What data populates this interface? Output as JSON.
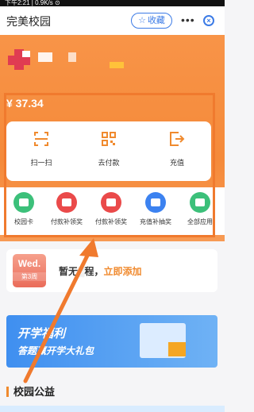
{
  "status_bar": {
    "text": "下午2:21 | 0.9K/s ⊙"
  },
  "app_bar": {
    "title": "完美校园",
    "favorite_label": "收藏",
    "more_icon": "more-dots-icon",
    "close_icon": "close-circle-icon"
  },
  "wallet": {
    "balance": "¥ 37.34"
  },
  "actions": [
    {
      "label": "扫一扫",
      "icon": "scan-icon"
    },
    {
      "label": "去付款",
      "icon": "qrcode-icon"
    },
    {
      "label": "充值",
      "icon": "recharge-icon"
    }
  ],
  "apps": [
    {
      "label": "校园卡",
      "color": "#3cc07a"
    },
    {
      "label": "付款补领奖",
      "color": "#ea4a4a"
    },
    {
      "label": "付款补领奖",
      "color": "#ea4a4a"
    },
    {
      "label": "充值补抽奖",
      "color": "#3c82f0"
    },
    {
      "label": "全部应用",
      "color": "#3cc07a"
    }
  ],
  "schedule": {
    "day": "Wed.",
    "week": "第3周",
    "text_prefix": "暂无",
    "text_mid": "程，",
    "link": "立即添加"
  },
  "banner": {
    "line1": "开学福利",
    "line2": "答题赢开学大礼包"
  },
  "section": {
    "title": "校园公益"
  }
}
